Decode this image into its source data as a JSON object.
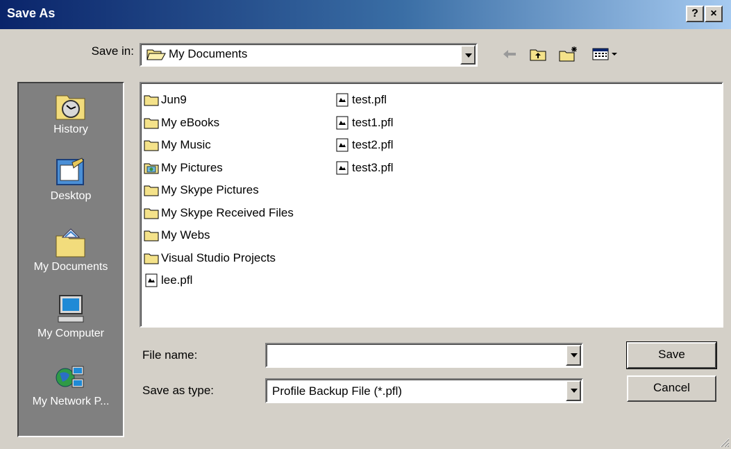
{
  "window": {
    "title": "Save As",
    "help_button": "?",
    "close_button": "×"
  },
  "save_in": {
    "label": "Save in:",
    "value": "My Documents"
  },
  "toolbar": {
    "icons": [
      "back-arrow-icon",
      "up-folder-icon",
      "new-folder-icon",
      "view-menu-icon"
    ]
  },
  "places": [
    {
      "label": "History",
      "icon": "history-icon"
    },
    {
      "label": "Desktop",
      "icon": "desktop-icon"
    },
    {
      "label": "My Documents",
      "icon": "my-documents-icon"
    },
    {
      "label": "My Computer",
      "icon": "my-computer-icon"
    },
    {
      "label": "My Network P...",
      "icon": "network-places-icon"
    }
  ],
  "files": {
    "column1": [
      {
        "name": "Jun9",
        "type": "folder"
      },
      {
        "name": "My eBooks",
        "type": "folder"
      },
      {
        "name": "My Music",
        "type": "folder"
      },
      {
        "name": "My Pictures",
        "type": "pictures-folder"
      },
      {
        "name": "My Skype Pictures",
        "type": "folder"
      },
      {
        "name": "My Skype Received Files",
        "type": "folder"
      },
      {
        "name": "My Webs",
        "type": "folder"
      },
      {
        "name": "Visual Studio Projects",
        "type": "folder"
      },
      {
        "name": "lee.pfl",
        "type": "file"
      }
    ],
    "column2": [
      {
        "name": "test.pfl",
        "type": "file"
      },
      {
        "name": "test1.pfl",
        "type": "file"
      },
      {
        "name": "test2.pfl",
        "type": "file"
      },
      {
        "name": "test3.pfl",
        "type": "file"
      }
    ]
  },
  "file_name": {
    "label": "File name:",
    "value": ""
  },
  "save_as_type": {
    "label": "Save as type:",
    "value": "Profile Backup File (*.pfl)"
  },
  "buttons": {
    "save": "Save",
    "cancel": "Cancel"
  }
}
